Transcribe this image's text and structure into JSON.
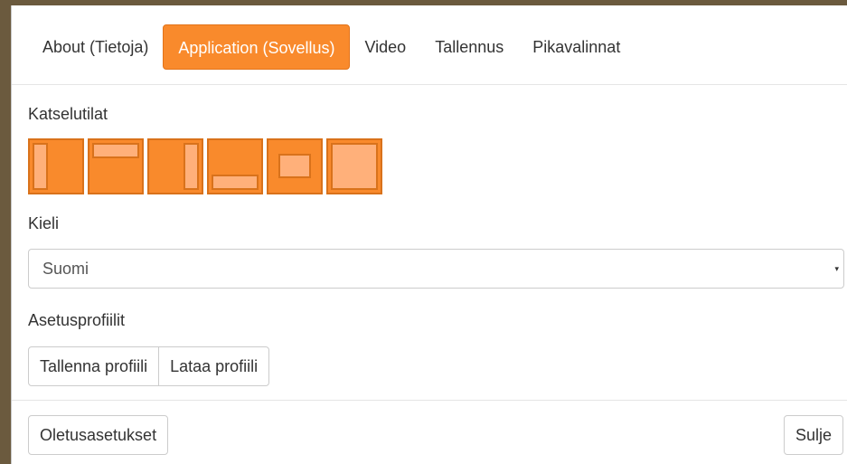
{
  "tabs": [
    {
      "label": "About (Tietoja)",
      "active": false
    },
    {
      "label": "Application (Sovellus)",
      "active": true
    },
    {
      "label": "Video",
      "active": false
    },
    {
      "label": "Tallennus",
      "active": false
    },
    {
      "label": "Pikavalinnat",
      "active": false
    }
  ],
  "view_modes": {
    "label": "Katselutilat",
    "modes": [
      "left-panel",
      "top-panel",
      "right-panel",
      "bottom-panel",
      "center-window",
      "fullscreen"
    ]
  },
  "language": {
    "label": "Kieli",
    "selected": "Suomi",
    "caret": "▾"
  },
  "profiles": {
    "label": "Asetusprofiilit",
    "save_label": "Tallenna profiili",
    "load_label": "Lataa profiili"
  },
  "footer": {
    "defaults_label": "Oletusasetukset",
    "close_label": "Sulje"
  },
  "colors": {
    "accent": "#f98a2c",
    "accent_light": "#ffb07a",
    "accent_border": "#d9721b"
  }
}
